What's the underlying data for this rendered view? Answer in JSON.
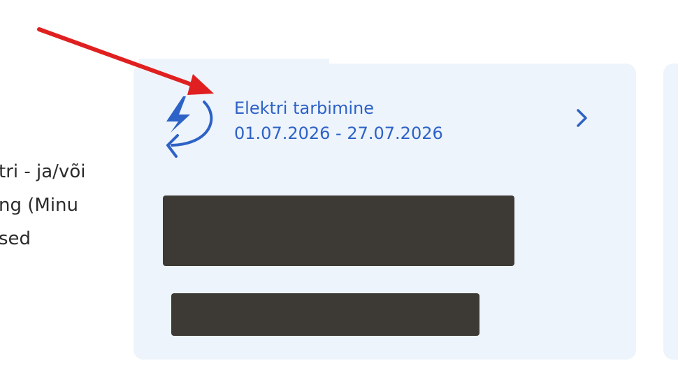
{
  "left_text": {
    "line1": "tri - ja/või",
    "line2": "ng (Minu",
    "line3": "sed"
  },
  "card": {
    "title": "Elektri tarbimine",
    "period": "01.07.2026 - 27.07.2026",
    "icon": "electricity-usage-icon",
    "chevron_icon": "chevron-right-icon"
  },
  "annotation": {
    "arrow_color": "#e02020"
  },
  "colors": {
    "accent": "#2d62c6",
    "card_bg": "#eef4fc",
    "redaction": "#3d3a36"
  }
}
